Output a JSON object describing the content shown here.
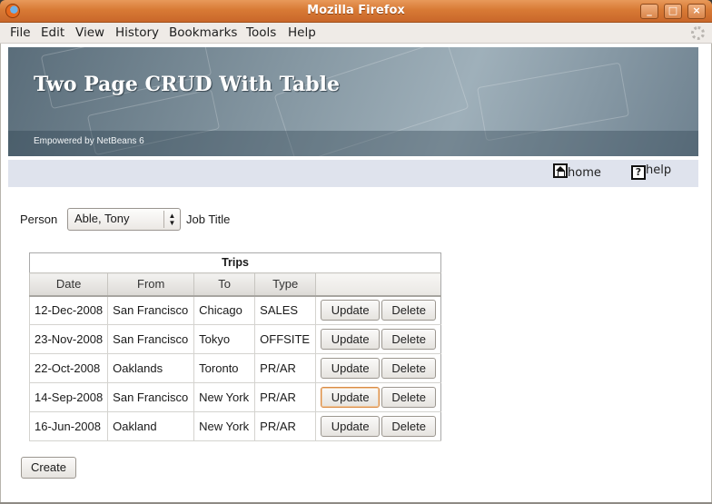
{
  "window": {
    "title": "Mozilla Firefox",
    "min_glyph": "_",
    "max_glyph": "□",
    "close_glyph": "×"
  },
  "menu": [
    "File",
    "Edit",
    "View",
    "History",
    "Bookmarks",
    "Tools",
    "Help"
  ],
  "banner": {
    "title": "Two Page CRUD With Table",
    "subtitle": "Empowered by NetBeans 6"
  },
  "nav": {
    "home": "home",
    "help": "help",
    "help_glyph": "?"
  },
  "form": {
    "person_label": "Person",
    "person_selected": "Able, Tony",
    "job_title_label": "Job Title"
  },
  "table": {
    "caption": "Trips",
    "headers": [
      "Date",
      "From",
      "To",
      "Type"
    ],
    "rows": [
      {
        "date": "12-Dec-2008",
        "from": "San Francisco",
        "to": "Chicago",
        "type": "SALES"
      },
      {
        "date": "23-Nov-2008",
        "from": "San Francisco",
        "to": "Tokyo",
        "type": "OFFSITE"
      },
      {
        "date": "22-Oct-2008",
        "from": "Oaklands",
        "to": "Toronto",
        "type": "PR/AR"
      },
      {
        "date": "14-Sep-2008",
        "from": "San Francisco",
        "to": "New York",
        "type": "PR/AR"
      },
      {
        "date": "16-Jun-2008",
        "from": "Oakland",
        "to": "New York",
        "type": "PR/AR"
      }
    ],
    "update_label": "Update",
    "delete_label": "Delete"
  },
  "create_label": "Create"
}
